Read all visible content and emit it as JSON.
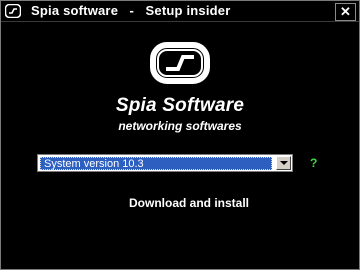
{
  "window": {
    "title": "Spia software   -   Setup insider",
    "close_label": "✕",
    "icon": "app-logo-icon"
  },
  "brand": {
    "logo": "spia-logo-icon",
    "name": "Spia Software",
    "tagline": "networking softwares"
  },
  "form": {
    "version_selected": "System version 10.3",
    "dropdown_icon": "chevron-down-icon",
    "help_label": "?",
    "install_label": "Download and install"
  },
  "colors": {
    "background": "#000000",
    "selection": "#2d5fc1",
    "help": "#3cd93c"
  }
}
